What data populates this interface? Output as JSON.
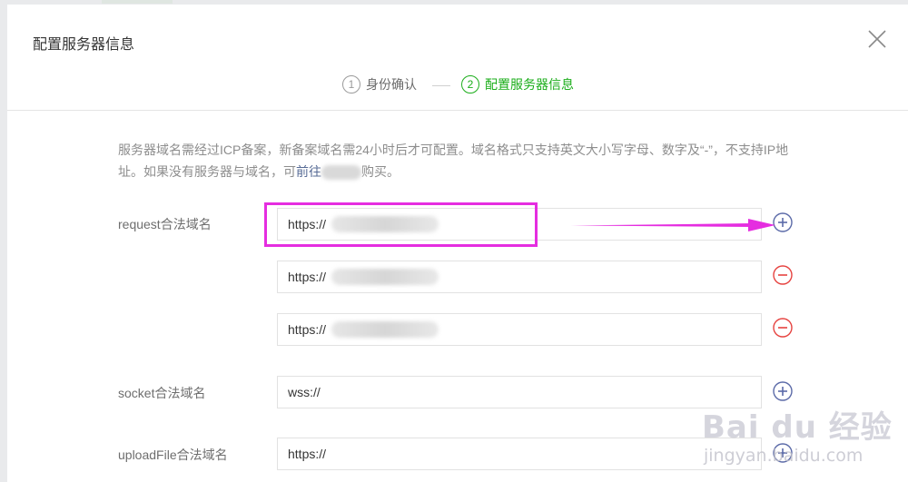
{
  "dialog": {
    "title": "配置服务器信息"
  },
  "steps": [
    {
      "num": "1",
      "label": "身份确认",
      "active": false
    },
    {
      "num": "2",
      "label": "配置服务器信息",
      "active": true
    }
  ],
  "notice": {
    "text_before_link": "服务器域名需经过ICP备案，新备案域名需24小时后才可配置。域名格式只支持英文大小写字母、数字及“-”，不支持IP地址。如果没有服务器与域名，可",
    "link_text": "前往",
    "text_after_link": "购买。"
  },
  "fields": {
    "request": {
      "label": "request合法域名",
      "values": [
        "https://",
        "https://",
        "https://"
      ]
    },
    "socket": {
      "label": "socket合法域名",
      "value": "wss://"
    },
    "uploadFile": {
      "label": "uploadFile合法域名",
      "value": "https://"
    }
  },
  "icons": {
    "close": "close-icon",
    "add": "plus-circle-icon",
    "remove": "minus-circle-icon"
  },
  "colors": {
    "accent_green": "#1aad19",
    "annotation_magenta": "#e52de0",
    "add_blue": "#5b6aa8",
    "remove_red": "#e64340",
    "link_blue": "#576b95"
  },
  "watermark": {
    "logo": "Bai du 经验",
    "url": "jingyan.baidu.com"
  }
}
